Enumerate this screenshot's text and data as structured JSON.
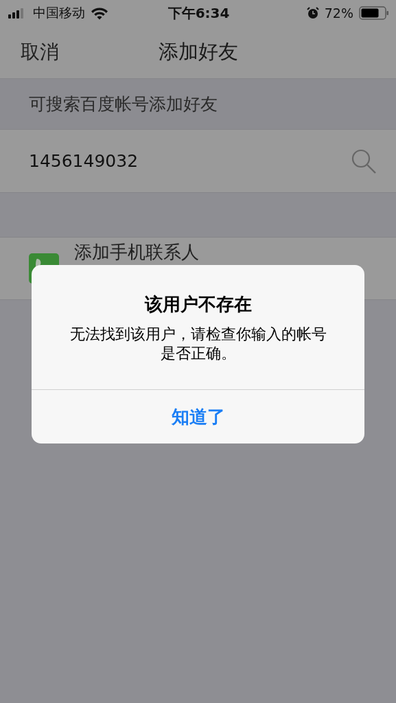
{
  "status_bar": {
    "carrier": "中国移动",
    "time": "下午6:34",
    "battery": "72%"
  },
  "nav": {
    "cancel": "取消",
    "title": "添加好友"
  },
  "section_header": "可搜索百度帐号添加好友",
  "search": {
    "value": "1456149032"
  },
  "contact_row": {
    "label": "添加手机联系人"
  },
  "alert": {
    "title": "该用户不存在",
    "message": "无法找到该用户，请检查你输入的帐号是否正确。",
    "button": "知道了"
  }
}
